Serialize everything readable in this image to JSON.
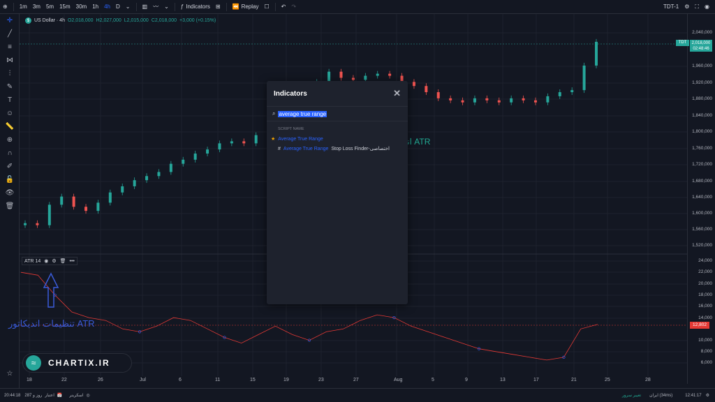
{
  "topbar": {
    "intervals": [
      "1m",
      "3m",
      "5m",
      "15m",
      "30m",
      "1h",
      "4h",
      "D"
    ],
    "active_interval": "4h",
    "indicators_label": "Indicators",
    "replay_label": "Replay",
    "symbol_code": "TDT-1"
  },
  "legend": {
    "symbol": "US Dollar · 4h",
    "o": "O2,018,000",
    "h": "H2,027,000",
    "l": "L2,015,000",
    "c": "C2,018,000",
    "change": "+3,000 (+0.15%)"
  },
  "atr_legend": {
    "label": "ATR 14"
  },
  "price_axis": [
    "2,040,000",
    "1,960,000",
    "1,920,000",
    "1,880,000",
    "1,840,000",
    "1,800,000",
    "1,760,000",
    "1,720,000",
    "1,680,000",
    "1,640,000",
    "1,600,000",
    "1,560,000",
    "1,520,000"
  ],
  "atr_axis": [
    "24,000",
    "22,000",
    "20,000",
    "18,000",
    "16,000",
    "14,000",
    "10,000",
    "8,000",
    "6,000"
  ],
  "current_price": {
    "tag": "TDT",
    "value": "2,018,000",
    "countdown": "02:48:46",
    "color": "#26a69a"
  },
  "atr_value": {
    "value": "12,802",
    "color": "#e53935"
  },
  "time_axis": [
    "18",
    "22",
    "26",
    "Jul",
    "6",
    "11",
    "15",
    "19",
    "23",
    "27",
    "Aug",
    "5",
    "9",
    "13",
    "17",
    "21",
    "25",
    "28"
  ],
  "modal": {
    "title": "Indicators",
    "search_value": "average true range",
    "section_label": "SCRIPT NAME",
    "results": [
      {
        "name": "Average True Range",
        "suffix": ""
      },
      {
        "name": "Average True Range",
        "suffix": "Stop Loss Finder-اختصاصی"
      }
    ]
  },
  "annotations": {
    "atr_indicator": "اندیکاتور ATR",
    "atr_settings": "تنظیمات اندیکاتور ATR"
  },
  "logo": {
    "text": "CHARTIX.IR"
  },
  "bottombar": {
    "left_time": "20:44:18",
    "days": "287 روز و",
    "credit": "اعتبار",
    "screener": "اسکرینر",
    "server": "تغییر سرور",
    "ping": "ایران (34ms)",
    "clock": "12:41:17"
  },
  "colors": {
    "up": "#26a69a",
    "down": "#ef5350",
    "bg": "#131722",
    "accent": "#2962ff"
  },
  "chart_data": [
    {
      "type": "candlestick",
      "series": [
        {
          "name": "US Dollar · 4h",
          "values": [
            1575000,
            1570000,
            1620000,
            1640000,
            1615000,
            1605000,
            1625000,
            1650000,
            1665000,
            1680000,
            1690000,
            1700000,
            1720000,
            1730000,
            1745000,
            1755000,
            1770000,
            1775000,
            1770000,
            1790000,
            1800000,
            1830000,
            1860000,
            1890000,
            1920000,
            1945000,
            1930000,
            1925000,
            1935000,
            1940000,
            1935000,
            1920000,
            1910000,
            1895000,
            1880000,
            1875000,
            1870000,
            1880000,
            1875000,
            1870000,
            1880000,
            1875000,
            1870000,
            1885000,
            1895000,
            1900000,
            1960000,
            2018000
          ]
        }
      ],
      "ylim": [
        1520000,
        2040000
      ]
    },
    {
      "type": "line",
      "series": [
        {
          "name": "ATR 14",
          "values": [
            22000,
            21500,
            18000,
            15000,
            14000,
            13500,
            12000,
            11500,
            12500,
            14000,
            13500,
            12000,
            10500,
            9500,
            11000,
            12500,
            11000,
            10000,
            11500,
            12000,
            13500,
            14500,
            14000,
            12500,
            11500,
            10500,
            9500,
            8500,
            8000,
            7500,
            7000,
            6500,
            7000,
            12000,
            12802
          ]
        }
      ],
      "ylim": [
        5000,
        25000
      ]
    }
  ]
}
